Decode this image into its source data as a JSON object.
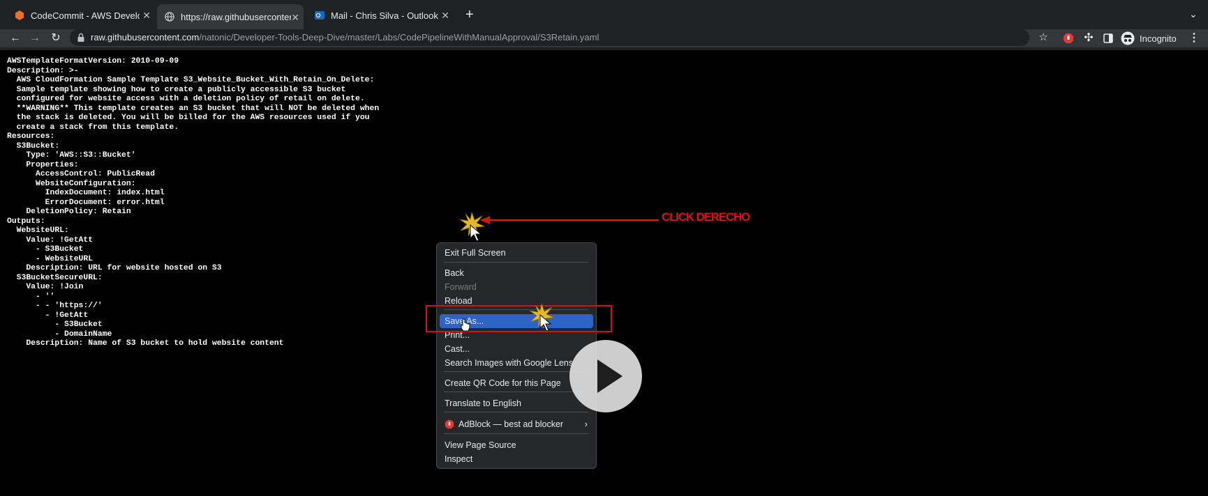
{
  "browser": {
    "tabs": [
      {
        "title": "CodeCommit - AWS Developer",
        "favicon": "aws-codecommit-icon",
        "active": false
      },
      {
        "title": "https://raw.githubusercontent.c",
        "favicon": "globe-icon",
        "active": true
      },
      {
        "title": "Mail - Chris Silva - Outlook",
        "favicon": "outlook-icon",
        "active": false
      }
    ],
    "url_host": "raw.githubusercontent.com",
    "url_path": "/natonic/Developer-Tools-Deep-Dive/master/Labs/CodePipelineWithManualApproval/S3Retain.yaml",
    "profile_label": "Incognito"
  },
  "content": {
    "yaml": "AWSTemplateFormatVersion: 2010-09-09\nDescription: >-\n  AWS CloudFormation Sample Template S3_Website_Bucket_With_Retain_On_Delete:\n  Sample template showing how to create a publicly accessible S3 bucket\n  configured for website access with a deletion policy of retail on delete.\n  **WARNING** This template creates an S3 bucket that will NOT be deleted when\n  the stack is deleted. You will be billed for the AWS resources used if you\n  create a stack from this template.\nResources:\n  S3Bucket:\n    Type: 'AWS::S3::Bucket'\n    Properties:\n      AccessControl: PublicRead\n      WebsiteConfiguration:\n        IndexDocument: index.html\n        ErrorDocument: error.html\n    DeletionPolicy: Retain\nOutputs:\n  WebsiteURL:\n    Value: !GetAtt\n      - S3Bucket\n      - WebsiteURL\n    Description: URL for website hosted on S3\n  S3BucketSecureURL:\n    Value: !Join\n      - ''\n      - - 'https://'\n        - !GetAtt\n          - S3Bucket\n          - DomainName\n    Description: Name of S3 bucket to hold website content"
  },
  "context_menu": {
    "exit_full_screen": "Exit Full Screen",
    "back": "Back",
    "forward": "Forward",
    "reload": "Reload",
    "save_as": "Save As...",
    "print": "Print...",
    "cast": "Cast...",
    "search_images": "Search Images with Google Lens",
    "create_qr": "Create QR Code for this Page",
    "translate": "Translate to English",
    "adblock": "AdBlock — best ad blocker",
    "view_source": "View Page Source",
    "inspect": "Inspect"
  },
  "annotation": {
    "label": "CLICK DERECHO",
    "color": "#d51515"
  }
}
